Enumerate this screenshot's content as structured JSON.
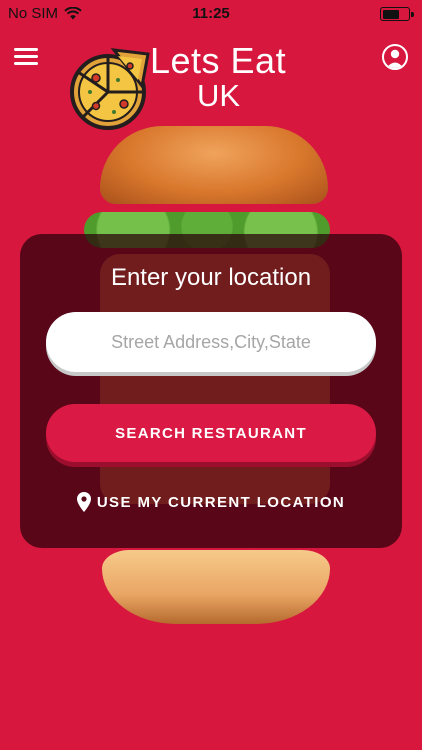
{
  "status_bar": {
    "carrier": "No SIM",
    "time": "11:25",
    "wifi_icon": "wifi-icon",
    "battery_icon": "battery-icon"
  },
  "header": {
    "menu_icon": "hamburger-menu-icon",
    "profile_icon": "user-profile-icon",
    "brand_title": "Lets Eat",
    "brand_subtitle": "UK"
  },
  "search_card": {
    "title": "Enter your location",
    "address_placeholder": "Street Address,City,State",
    "address_value": "",
    "search_button_label": "SEARCH RESTAURANT",
    "current_location_icon": "map-pin-icon",
    "current_location_label": "USE MY CURRENT LOCATION"
  },
  "colors": {
    "background": "#d8173e",
    "button": "#da1a45",
    "card_overlay": "rgba(40,0,10,0.72)"
  }
}
